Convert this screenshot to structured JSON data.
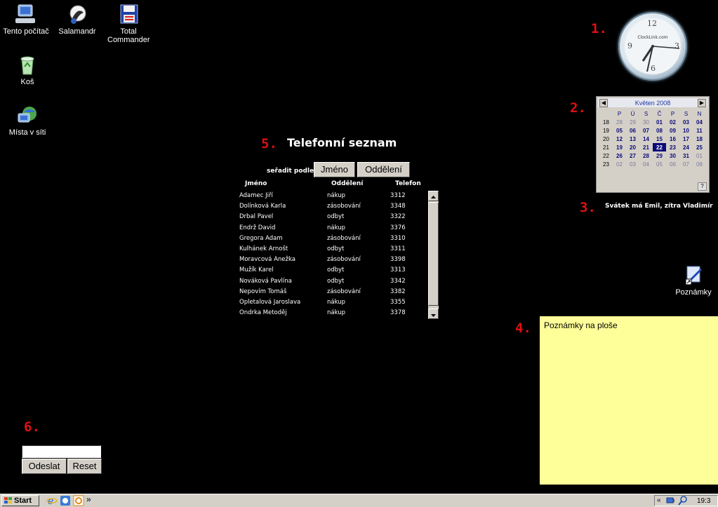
{
  "desktop": {
    "icons": [
      {
        "label": "Tento počítač"
      },
      {
        "label": "Salamandr"
      },
      {
        "label": "Total Commander"
      },
      {
        "label": "Koš"
      },
      {
        "label": "Místa v síti"
      },
      {
        "label": "Poznámky"
      }
    ]
  },
  "markers": [
    "1.",
    "2.",
    "3.",
    "4.",
    "5.",
    "6."
  ],
  "clock": {
    "brand": "ClockLink.com",
    "numbers": [
      "12",
      "3",
      "6",
      "9"
    ]
  },
  "calendar": {
    "month_label": "Květen 2008",
    "prev": "◀",
    "next": "▶",
    "help": "?",
    "weekdays": [
      "P",
      "Ú",
      "S",
      "Č",
      "P",
      "S",
      "N"
    ],
    "weeks": [
      {
        "wk": "18",
        "days": [
          "28",
          "29",
          "30",
          "01",
          "02",
          "03",
          "04"
        ]
      },
      {
        "wk": "19",
        "days": [
          "05",
          "06",
          "07",
          "08",
          "09",
          "10",
          "11"
        ]
      },
      {
        "wk": "20",
        "days": [
          "12",
          "13",
          "14",
          "15",
          "16",
          "17",
          "18"
        ]
      },
      {
        "wk": "21",
        "days": [
          "19",
          "20",
          "21",
          "22",
          "23",
          "24",
          "25"
        ]
      },
      {
        "wk": "22",
        "days": [
          "26",
          "27",
          "28",
          "29",
          "30",
          "31",
          "01"
        ]
      },
      {
        "wk": "23",
        "days": [
          "02",
          "03",
          "04",
          "05",
          "06",
          "07",
          "08"
        ]
      }
    ],
    "today": "22"
  },
  "namesday": "Svátek má Emil, zítra Vladimír",
  "phonebook": {
    "title": "Telefonní seznam",
    "sort_label": "seřadit podle -",
    "sort_buttons": [
      "Jméno",
      "Oddělení"
    ],
    "columns": [
      "Jméno",
      "Oddělení",
      "Telefon"
    ],
    "rows": [
      {
        "name": "Adamec Jiří",
        "dept": "nákup",
        "phone": "3312"
      },
      {
        "name": "Dolínková Karla",
        "dept": "zásobování",
        "phone": "3348"
      },
      {
        "name": "Drbal Pavel",
        "dept": "odbyt",
        "phone": "3322"
      },
      {
        "name": "Endrž David",
        "dept": "nákup",
        "phone": "3376"
      },
      {
        "name": "Gregora Adam",
        "dept": "zásobování",
        "phone": "3310"
      },
      {
        "name": "Kulhánek Arnošt",
        "dept": "odbyt",
        "phone": "3311"
      },
      {
        "name": "Moravcová Anežka",
        "dept": "zásobování",
        "phone": "3398"
      },
      {
        "name": "Mužík Karel",
        "dept": "odbyt",
        "phone": "3313"
      },
      {
        "name": "Nováková Pavlína",
        "dept": "odbyt",
        "phone": "3342"
      },
      {
        "name": "Nepovím Tomáš",
        "dept": "zásobování",
        "phone": "3382"
      },
      {
        "name": "Opletalová Jaroslava",
        "dept": "nákup",
        "phone": "3355"
      },
      {
        "name": "Ondrka Metoděj",
        "dept": "nákup",
        "phone": "3378"
      }
    ]
  },
  "notes": {
    "title": "Poznámky na ploše"
  },
  "form": {
    "input_value": "",
    "submit": "Odeslat",
    "reset": "Reset"
  },
  "taskbar": {
    "start": "Start",
    "more": "»",
    "tray_arrows": "«",
    "time": "19:3"
  },
  "colors": {
    "marker": "#e01010",
    "notes_bg": "#ffff99",
    "calendar_today": "#0a0a7a",
    "taskbar": "#d4d0c8"
  }
}
